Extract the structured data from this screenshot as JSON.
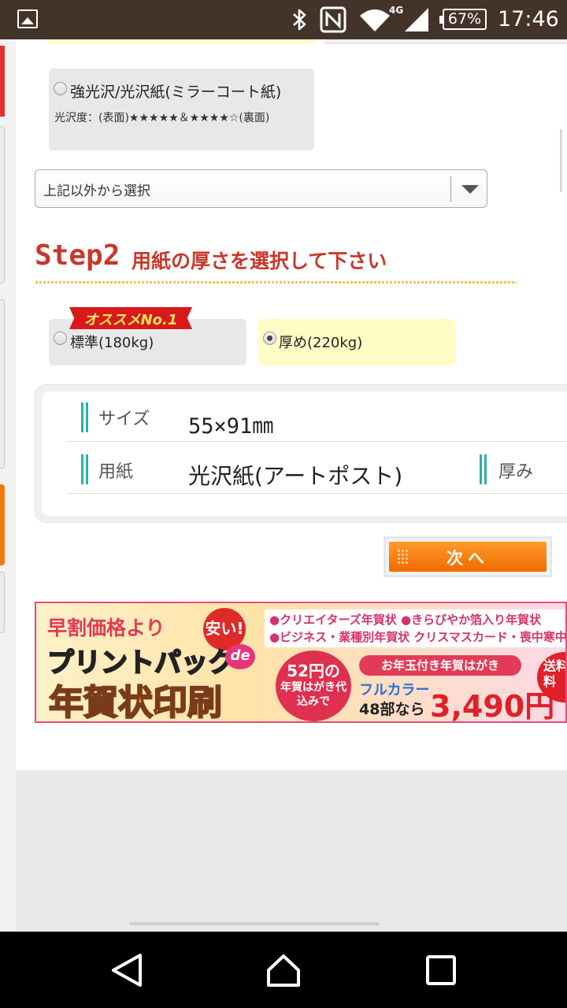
{
  "status_bar": {
    "network": "4G",
    "battery": "67%",
    "time": "17:46"
  },
  "paper_option": {
    "title": "強光沢/光沢紙(ミラーコート紙)",
    "gloss_note": "光沢度：(表面)★★★★★＆★★★★☆(裏面)",
    "selected": false
  },
  "paper_select": {
    "value": "上記以外から選択"
  },
  "step2": {
    "label": "Step2",
    "title": "用紙の厚さを選択して下さい",
    "badge": "オススメNo.1",
    "options": [
      {
        "label": "標準(180kg)",
        "selected": false
      },
      {
        "label": "厚め(220kg)",
        "selected": true
      }
    ]
  },
  "spec": {
    "size_key": "サイズ",
    "size_value": "55×91㎜",
    "paper_key": "用紙",
    "paper_value": "光沢紙(アートポスト)",
    "thickness_key": "厚み"
  },
  "next_button": {
    "label": "次へ"
  },
  "banner": {
    "early": "早割価格より",
    "cheap": "安い!",
    "brand": "プリントパック",
    "de": "de",
    "main": "年賀状印刷",
    "list_line1": "●クリエイターズ年賀状 ●きらびやか箔入り年賀状",
    "list_line2": "●ビジネス・業種別年賀状 クリスマスカード・喪中寒中",
    "circle_price": "52円の",
    "circle_note": "年賀はがき代込みで",
    "pill": "お年玉付き年賀はがき",
    "fullcolor": "フルカラー",
    "count": "48部なら",
    "price": "3,490円",
    "shipping": "送料無料"
  },
  "colors": {
    "status_bar": "#433329",
    "step_red": "#c8382b",
    "accent_teal": "#2bb0a6",
    "next_orange": "#f26a00",
    "selected_bg": "#fffcc5"
  }
}
